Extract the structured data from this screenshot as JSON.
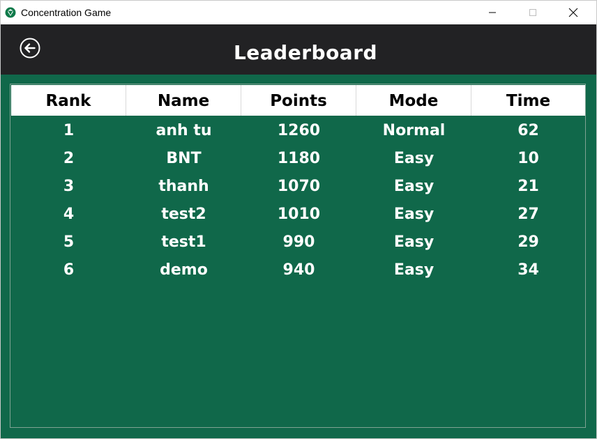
{
  "window": {
    "title": "Concentration Game",
    "icon": "green-gem-icon"
  },
  "header": {
    "title": "Leaderboard",
    "back_icon": "back-arrow-circle-icon"
  },
  "colors": {
    "header_bg": "#222224",
    "content_bg": "#10684a",
    "table_header_bg": "#ffffff"
  },
  "table": {
    "columns": [
      "Rank",
      "Name",
      "Points",
      "Mode",
      "Time"
    ],
    "rows": [
      [
        "1",
        "anh tu",
        "1260",
        "Normal",
        "62"
      ],
      [
        "2",
        "BNT",
        "1180",
        "Easy",
        "10"
      ],
      [
        "3",
        "thanh",
        "1070",
        "Easy",
        "21"
      ],
      [
        "4",
        "test2",
        "1010",
        "Easy",
        "27"
      ],
      [
        "5",
        "test1",
        "990",
        "Easy",
        "29"
      ],
      [
        "6",
        "demo",
        "940",
        "Easy",
        "34"
      ]
    ]
  }
}
